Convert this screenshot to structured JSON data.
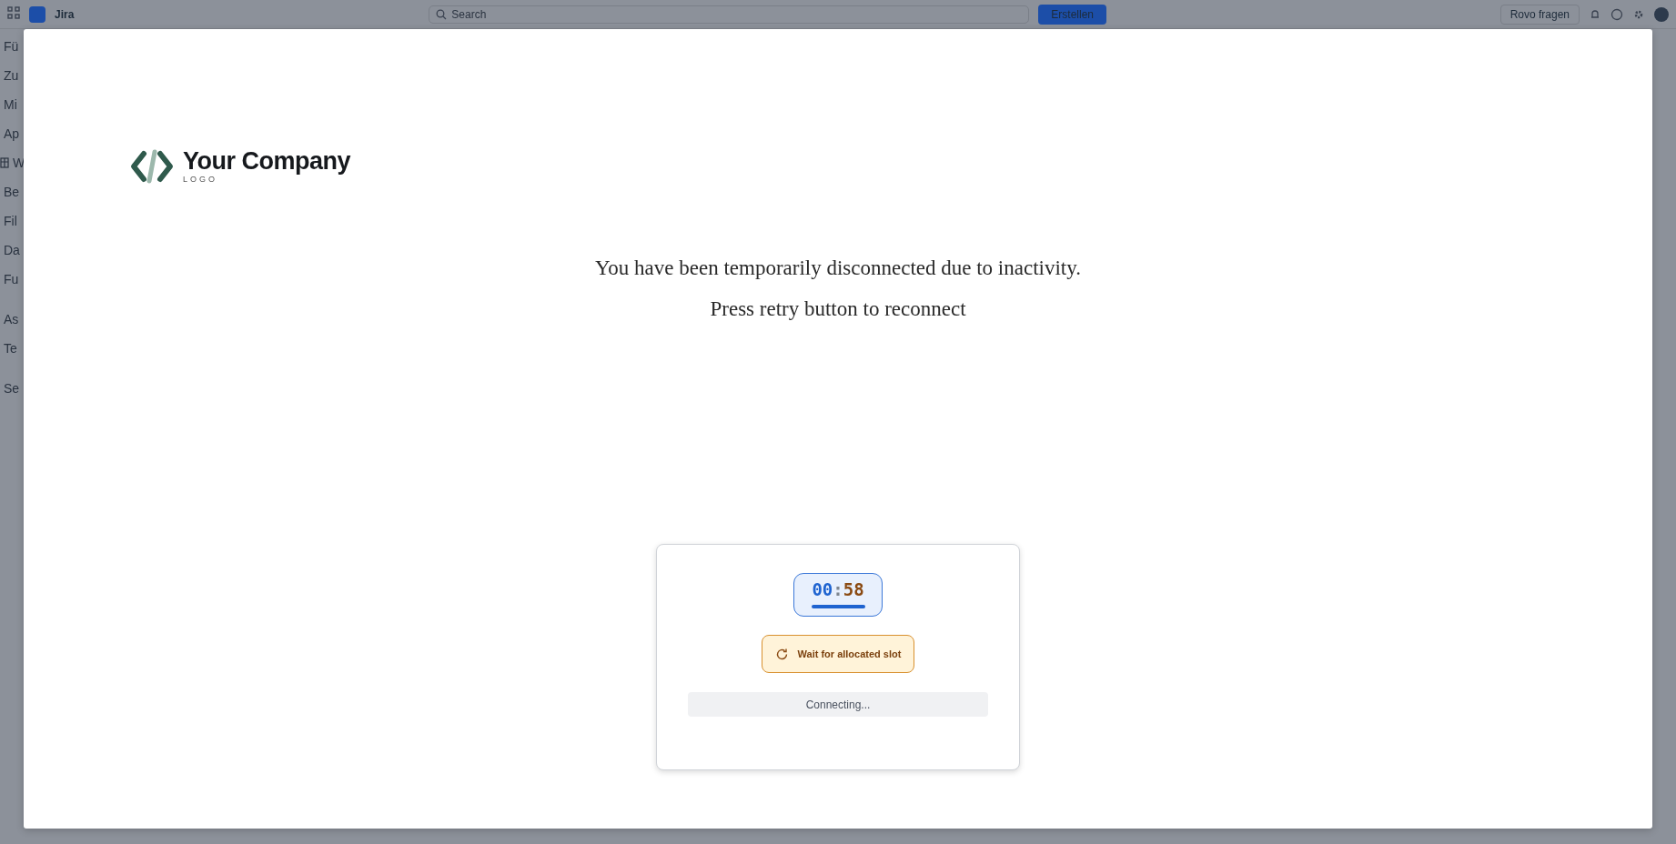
{
  "top_bar": {
    "app_name": "Jira",
    "search": {
      "placeholder": "Search"
    },
    "create_button": "Erstellen",
    "ask_button": "Rovo fragen"
  },
  "sidebar": {
    "items": [
      {
        "label": "Fü"
      },
      {
        "label": "Zu"
      },
      {
        "label": "Mi"
      },
      {
        "label": "Ap"
      },
      {
        "label": "W",
        "kind": "icon"
      },
      {
        "label": "Be"
      },
      {
        "label": "Fil"
      },
      {
        "label": "Da"
      },
      {
        "label": "Fu"
      },
      {
        "label": "As",
        "kind": "gap"
      },
      {
        "label": "Te"
      },
      {
        "label": "Se",
        "kind": "gap"
      }
    ]
  },
  "modal": {
    "logo": {
      "name": "Your Company",
      "tagline": "LOGO"
    },
    "messages": [
      "You have been temporarily disconnected due to inactivity.",
      "Press retry button to reconnect"
    ],
    "card": {
      "timer": {
        "minutes": "00",
        "separator": ":",
        "seconds": "58"
      },
      "status": "Wait for allocated slot",
      "progress": "Connecting..."
    }
  }
}
